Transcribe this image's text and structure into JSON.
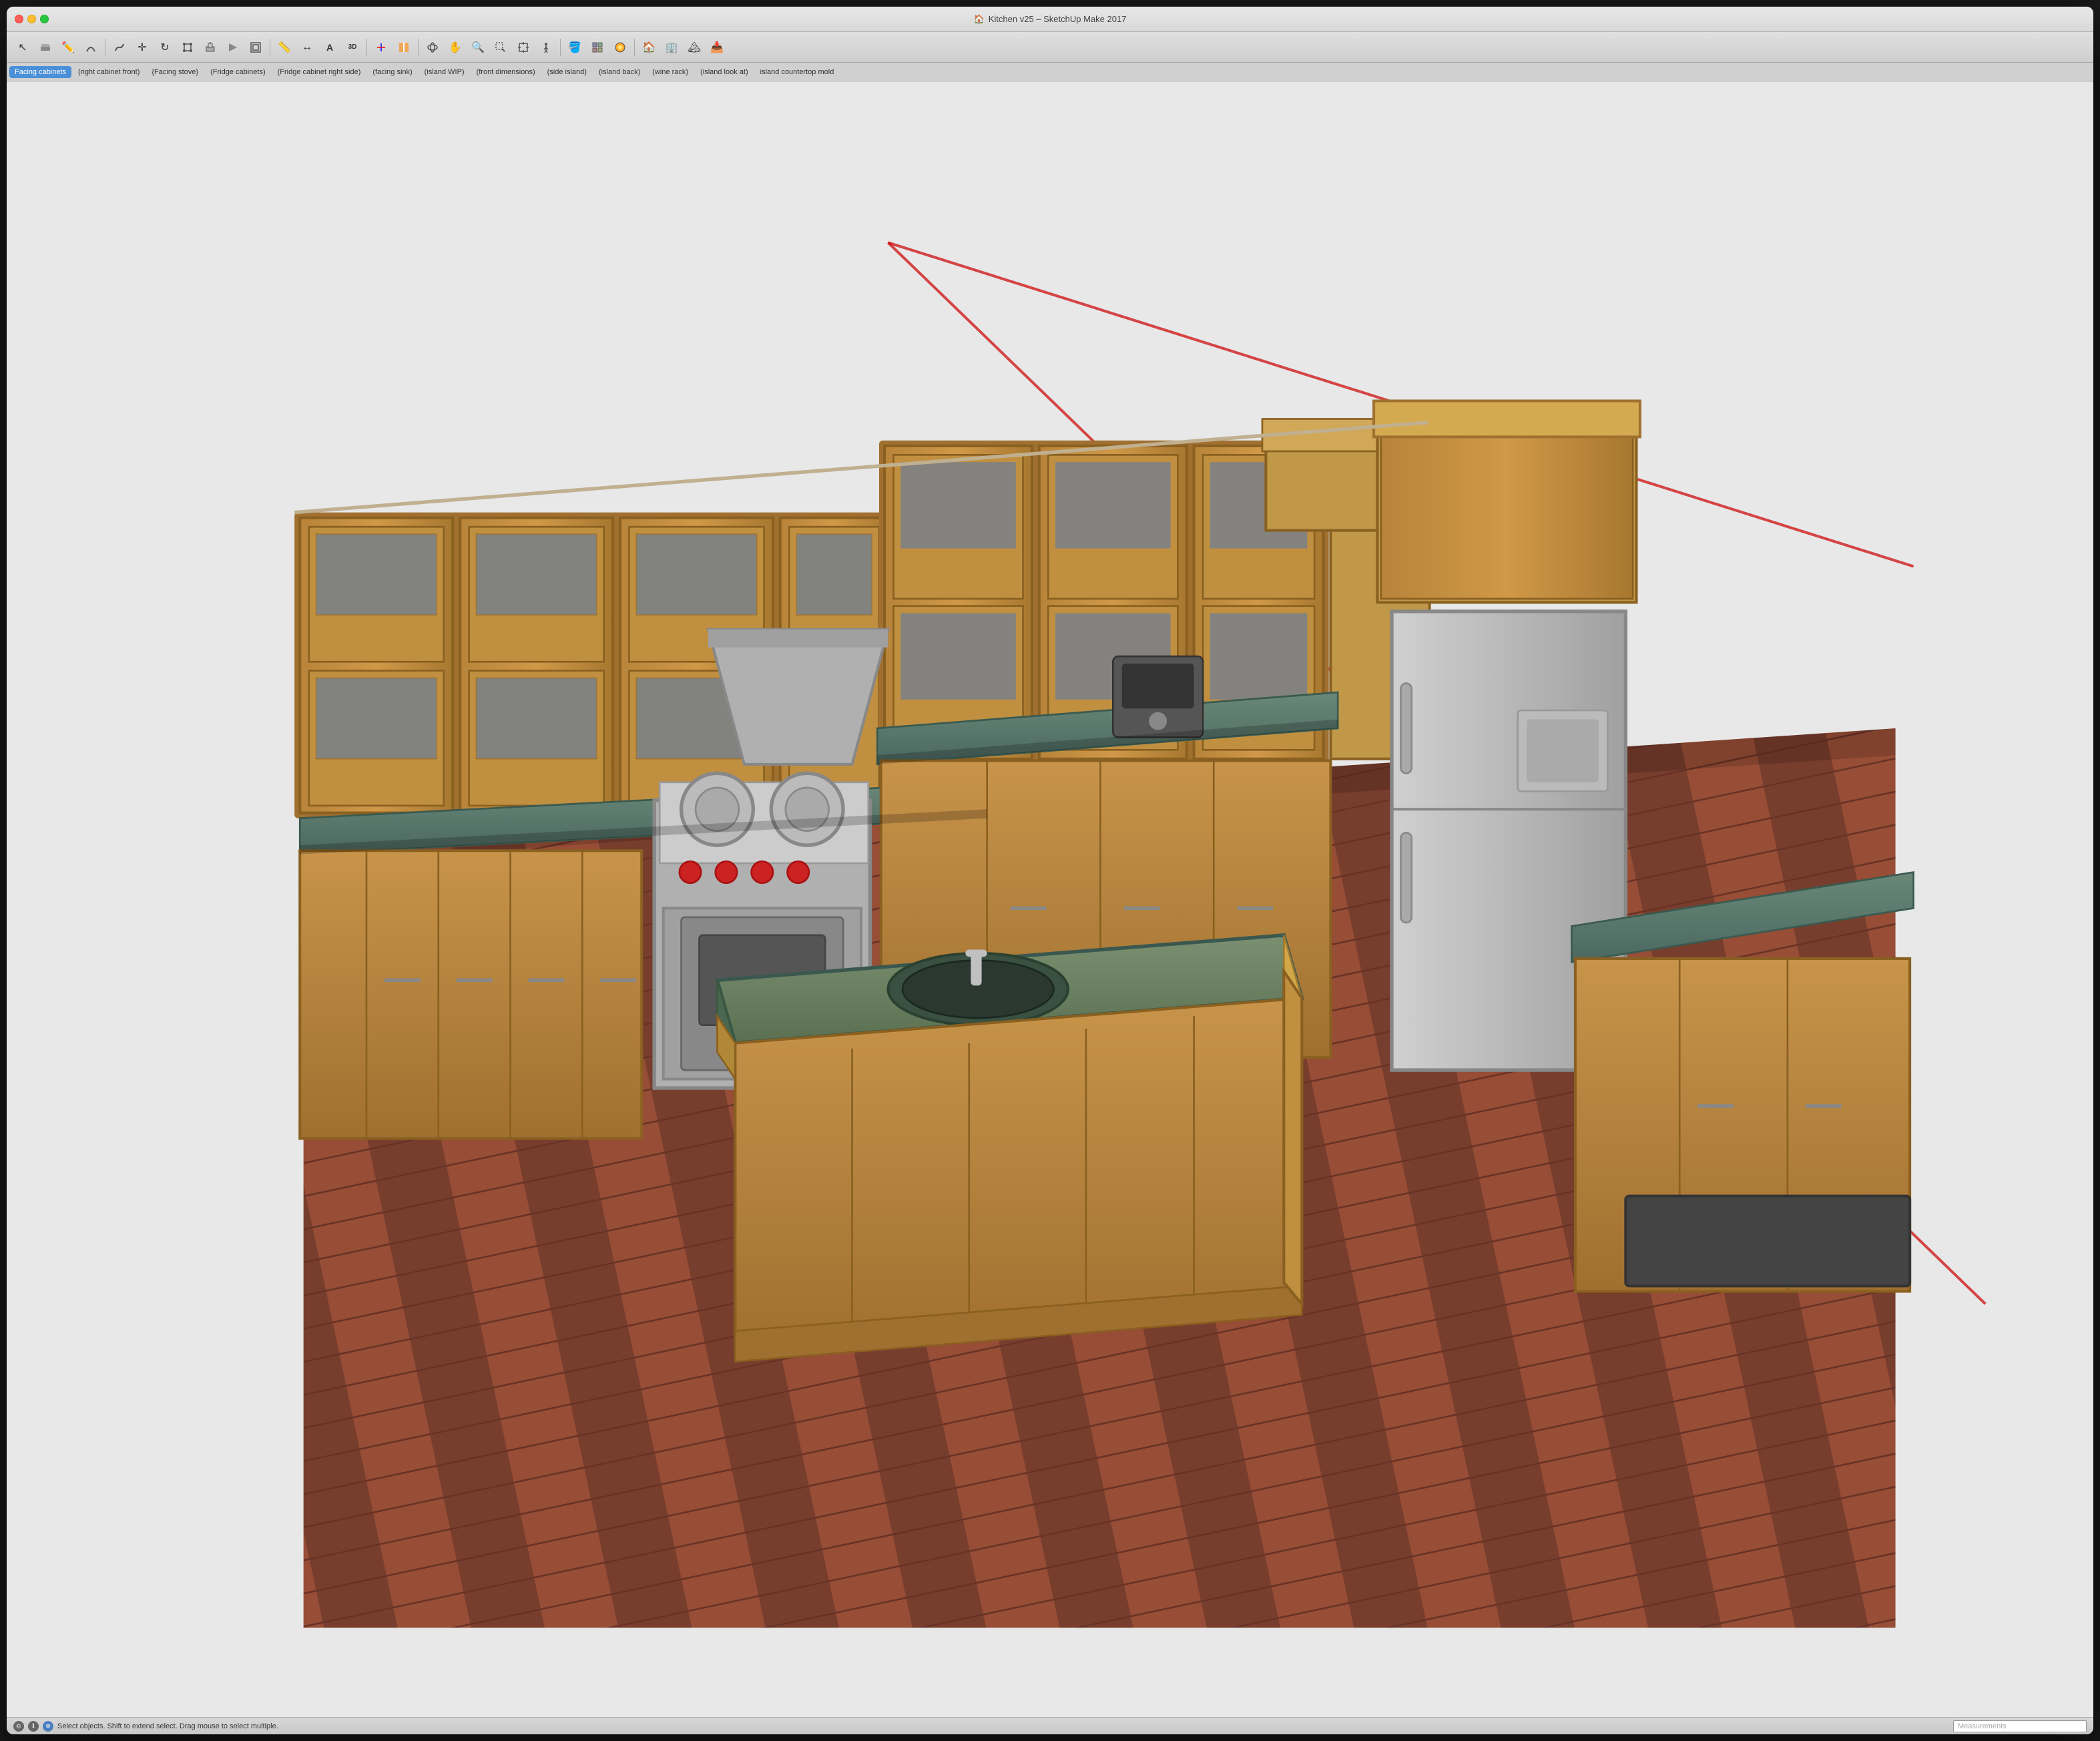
{
  "window": {
    "title": "Kitchen v25 – SketchUp Make 2017",
    "title_icon": "🏠"
  },
  "traffic_lights": {
    "close_label": "close",
    "minimize_label": "minimize",
    "maximize_label": "maximize"
  },
  "toolbar": {
    "tools": [
      {
        "name": "select",
        "icon": "↖",
        "label": "Select"
      },
      {
        "name": "eraser",
        "icon": "⬛",
        "label": "Eraser"
      },
      {
        "name": "pencil",
        "icon": "✏",
        "label": "Pencil"
      },
      {
        "name": "arc",
        "icon": "◠",
        "label": "Arc"
      },
      {
        "name": "freehand",
        "icon": "〜",
        "label": "Freehand"
      },
      {
        "name": "move",
        "icon": "✛",
        "label": "Move"
      },
      {
        "name": "rotate",
        "icon": "↻",
        "label": "Rotate"
      },
      {
        "name": "scale",
        "icon": "⬡",
        "label": "Scale"
      },
      {
        "name": "pushpull",
        "icon": "⬆",
        "label": "Push/Pull"
      },
      {
        "name": "followme",
        "icon": "↗",
        "label": "Follow Me"
      },
      {
        "name": "offset",
        "icon": "⬟",
        "label": "Offset"
      },
      {
        "name": "tape",
        "icon": "📏",
        "label": "Tape Measure"
      },
      {
        "name": "dimension",
        "icon": "↔",
        "label": "Dimension"
      },
      {
        "name": "text",
        "icon": "A",
        "label": "Text"
      },
      {
        "name": "3dtext",
        "icon": "Ⓐ",
        "label": "3D Text"
      },
      {
        "name": "axes",
        "icon": "✚",
        "label": "Axes"
      },
      {
        "name": "section",
        "icon": "⬛",
        "label": "Section Plane"
      },
      {
        "name": "camera_orbit",
        "icon": "↺",
        "label": "Orbit"
      },
      {
        "name": "camera_pan",
        "icon": "✋",
        "label": "Pan"
      },
      {
        "name": "zoom",
        "icon": "🔍",
        "label": "Zoom"
      },
      {
        "name": "zoomwindow",
        "icon": "⊕",
        "label": "Zoom Window"
      },
      {
        "name": "zoomextents",
        "icon": "⊞",
        "label": "Zoom Extents"
      },
      {
        "name": "walkthrough",
        "icon": "🚶",
        "label": "Walk Through"
      },
      {
        "name": "paint",
        "icon": "🪣",
        "label": "Paint Bucket"
      }
    ]
  },
  "tabs": [
    {
      "id": "facing-cabinets",
      "label": "Facing cabinets",
      "active": true
    },
    {
      "id": "right-cabinet-front",
      "label": "(right cabinet front)",
      "active": false
    },
    {
      "id": "facing-stove",
      "label": "{Facing stove}",
      "active": false
    },
    {
      "id": "fridge-cabinets",
      "label": "(Fridge cabinets)",
      "active": false
    },
    {
      "id": "fridge-cabinet-right-side",
      "label": "(Fridge cabinet right side)",
      "active": false
    },
    {
      "id": "facing-sink",
      "label": "(facing sink)",
      "active": false
    },
    {
      "id": "island-wip",
      "label": "(island WIP)",
      "active": false
    },
    {
      "id": "front-dimensions",
      "label": "(front dimensions)",
      "active": false
    },
    {
      "id": "side-island",
      "label": "(side island)",
      "active": false
    },
    {
      "id": "island-back",
      "label": "(island back)",
      "active": false
    },
    {
      "id": "wine-rack",
      "label": "(wine rack)",
      "active": false
    },
    {
      "id": "island-look-at",
      "label": "(island look at)",
      "active": false
    },
    {
      "id": "island-countertop-mold",
      "label": "island countertop mold",
      "active": false
    }
  ],
  "statusbar": {
    "status_text": "Select objects. Shift to extend select. Drag mouse to select multiple.",
    "measurements_label": "Measurements",
    "icons": [
      "©",
      "ℹ",
      "⊕"
    ]
  },
  "colors": {
    "active_tab": "#4a90d9",
    "wood_cabinet": "#c8934a",
    "wood_dark": "#a07030",
    "countertop": "#5a7a70",
    "floor_dark": "#6b2a1a",
    "floor_medium": "#8b3a22",
    "appliance_silver": "#b0b0b0",
    "appliance_dark": "#888",
    "fridge_body": "#c0c0c0",
    "range_body": "#999",
    "island_top": "#6a8060"
  }
}
